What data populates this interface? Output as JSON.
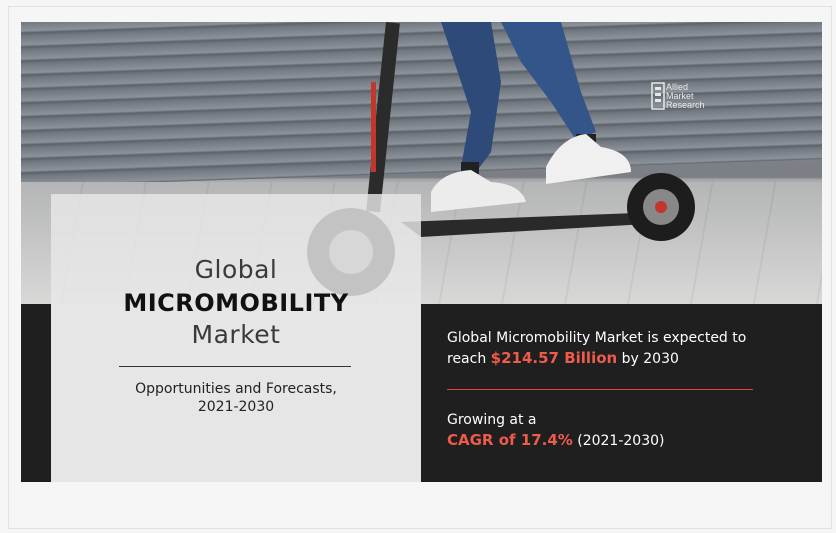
{
  "banner": {
    "title_line1": "Global",
    "title_line2": "MICROMOBILITY",
    "title_line3": "Market",
    "subtitle_line1": "Opportunities and Forecasts,",
    "subtitle_line2": "2021-2030",
    "stat1_prefix": "Global Micromobility Market is expected to",
    "stat1_reach": "reach",
    "stat1_value": "$214.57 Billion",
    "stat1_suffix": "by 2030",
    "stat2_prefix": "Growing at a",
    "stat2_value": "CAGR of 17.4%",
    "stat2_suffix": "(2021-2030)"
  },
  "logo": {
    "line1": "Allied",
    "line2": "Market",
    "line3": "Research"
  },
  "colors": {
    "accent": "#ef5b4b",
    "dark_band": "#1f1f1f",
    "panel": "#e6e6e6"
  }
}
